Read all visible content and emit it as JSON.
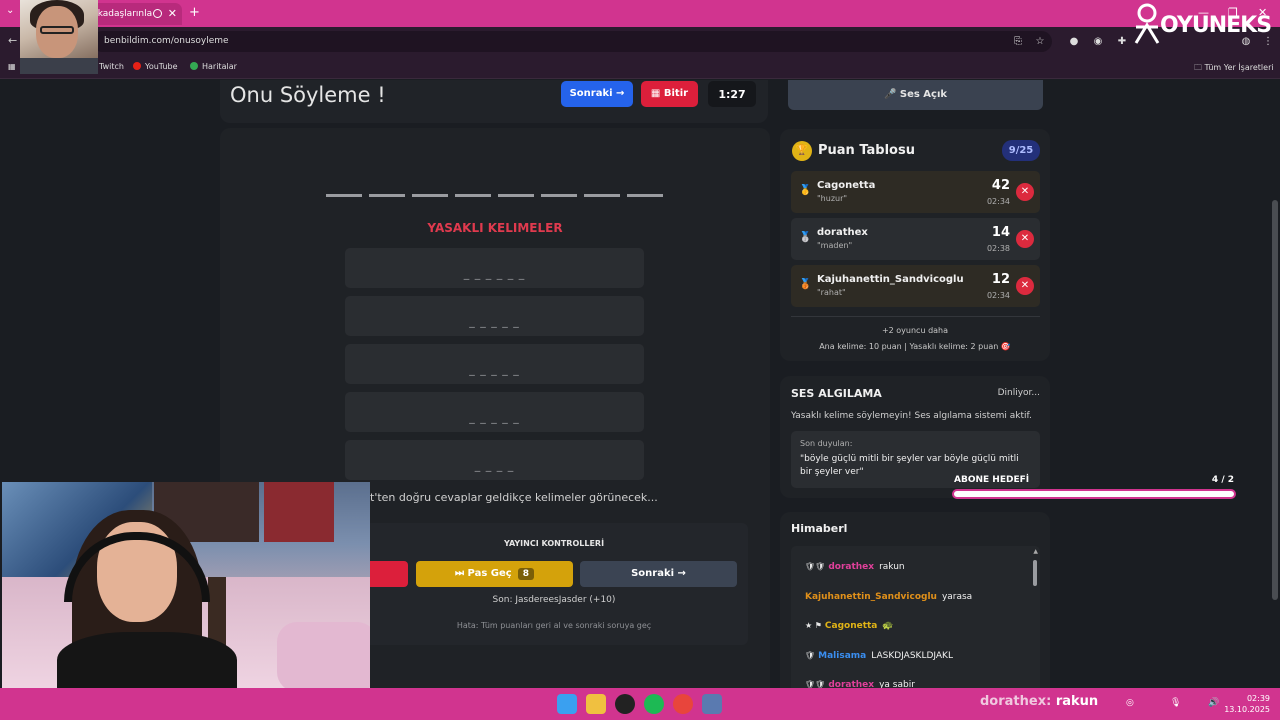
{
  "browser": {
    "tab_title": "rkadaşlarınla",
    "url": "benbildim.com/onusoyleme",
    "bookmarks": [
      "Twitch",
      "YouTube",
      "Haritalar"
    ],
    "all_bookmarks": "Tüm Yer İşaretleri"
  },
  "game": {
    "title": "Onu Söyleme !",
    "next_label": "Sonraki →",
    "finish_label": "Bitir",
    "timer": "1:27",
    "forbidden_title": "YASAKLI KELIMELER",
    "forbidden_words": [
      "_ _ _ _ _ _",
      "_ _ _ _ _",
      "_ _ _ _ _",
      "_ _ _ _ _",
      "_ _ _ _"
    ],
    "hint": "t'ten doğru cevaplar geldikçe kelimeler görünecek...",
    "controls": {
      "title": "YAYINCI KONTROLLERİ",
      "skip_label": "Pas Geç",
      "skip_count": "8",
      "next_label": "Sonraki →",
      "last": "Son: JasdereesJasder (+10)",
      "error": "Hata: Tüm puanları geri al ve sonraki soruya geç"
    }
  },
  "sound": {
    "label": "Ses Açık"
  },
  "scoreboard": {
    "title": "Puan Tablosu",
    "badge": "9/25",
    "players": [
      {
        "name": "Cagonetta",
        "word": "\"huzur\"",
        "points": "42",
        "time": "02:34",
        "medal": "🥇"
      },
      {
        "name": "dorathex",
        "word": "\"maden\"",
        "points": "14",
        "time": "02:38",
        "medal": "🥈"
      },
      {
        "name": "Kajuhanettin_Sandvicoglu",
        "word": "\"rahat\"",
        "points": "12",
        "time": "02:34",
        "medal": "🥉"
      }
    ],
    "more": "+2 oyuncu daha",
    "rules": "Ana kelime: 10 puan | Yasaklı kelime: 2 puan 🎯"
  },
  "voice": {
    "title": "SES ALGILAMA",
    "status": "Dinliyor...",
    "desc": "Yasaklı kelime söylemeyin! Ses algılama sistemi aktif.",
    "heard_label": "Son duyulan:",
    "heard_text": "\"böyle güçlü mitli bir şeyler var böyle güçlü mitli bir şeyler ver\""
  },
  "abone": {
    "label": "ABONE HEDEFİ",
    "count": "4 / 2",
    "progress": 1.0
  },
  "chat": {
    "title": "Himaberl",
    "messages": [
      {
        "user": "dorathex",
        "text": "rakun",
        "color": "#e0409a"
      },
      {
        "user": "Kajuhanettin_Sandvicoglu",
        "text": "yarasa",
        "color": "#e0901a"
      },
      {
        "user": "Cagonetta",
        "text": "🐢",
        "color": "#e0b316"
      },
      {
        "user": "Malisama",
        "text": "LASKDJASKLDJAKL",
        "color": "#3a8ef0"
      },
      {
        "user": "dorathex",
        "text": "ya sabir",
        "color": "#e0409a"
      }
    ]
  },
  "overlay": {
    "logo": "OYUNEKS",
    "ticker_user": "dorathex:",
    "ticker_msg": "rakun"
  },
  "taskbar": {
    "time": "02:39",
    "date": "13.10.2025"
  },
  "colors": {
    "accent": "#d1348f",
    "primary": "#2563eb",
    "danger": "#dc1f3b",
    "gold": "#d4a20b"
  }
}
